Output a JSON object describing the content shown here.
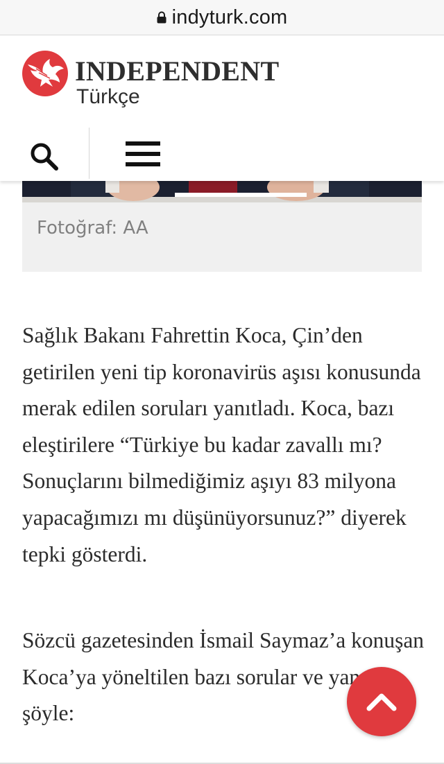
{
  "browser": {
    "url": "indyturk.com",
    "lock_icon": "lock-icon"
  },
  "header": {
    "logo_word": "INDEPENDENT",
    "logo_subtitle": "Türkçe",
    "logo_icon": "eagle-logo-icon",
    "brand_color": "#e03a3e",
    "search_icon": "search-icon",
    "menu_icon": "hamburger-menu-icon"
  },
  "image": {
    "caption": "Fotoğraf: AA"
  },
  "article": {
    "paragraphs": [
      "Sağlık Bakanı Fahrettin Koca, Çin’den getirilen yeni tip koronavirüs aşısı konusunda merak edilen soruları yanıtladı. Koca, bazı eleştirilere “Türkiye bu kadar zavallı mı? Sonuçlarını bilmediğimiz aşıyı 83 milyona yapacağımızı mı düşünüyorsunuz?” diyerek tepki gösterdi.",
      "Sözcü gazetesinden İsmail Saymaz’a konuşan Koca’ya yöneltilen bazı sorular ve yanıtları şöyle:"
    ]
  },
  "scroll_top": {
    "icon": "chevron-up-icon"
  }
}
